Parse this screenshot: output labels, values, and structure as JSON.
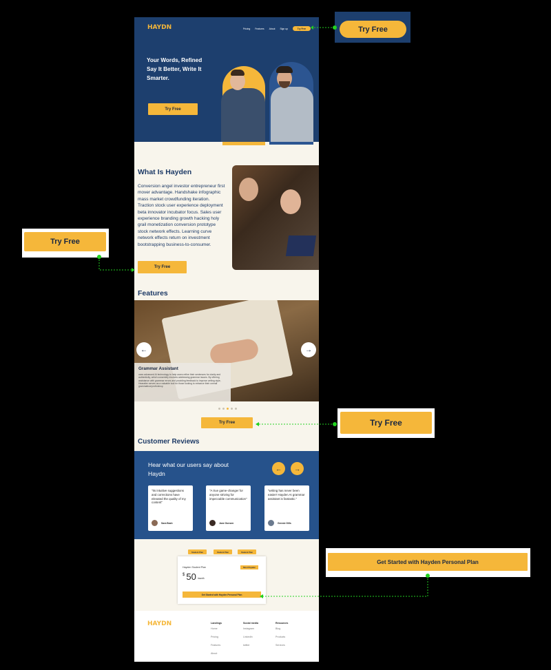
{
  "brand": {
    "logo": "HAYDN",
    "accent": "#f5b73a",
    "navy": "#1d3f6e",
    "blue": "#26528b"
  },
  "nav": {
    "items": [
      "Pricing",
      "Features",
      "About",
      "Sign up"
    ],
    "cta": "Try Free"
  },
  "hero": {
    "line1": "Your Words, Refined",
    "line2": "Say It Better, Write It",
    "line3": "Smarter.",
    "cta": "Try Free"
  },
  "about": {
    "title": "What Is Hayden",
    "body": "Conversion angel investor entrepreneur first mover advantage. Handshake infographic mass market crowdfunding iteration. Traction stock user experience deployment beta innovator incubator focus. Sales user experience branding growth hacking holy grail monetization conversion prototype stock network effects. Learning curve network effects return on investment bootstrapping business-to-consumer.",
    "cta": "Try Free"
  },
  "features": {
    "title": "Features",
    "card_title": "Grammar Assistant",
    "card_desc": "uses advanced AI technology to help users refine their sentences for clarity and authenticity, which concretely involves addressing grammar issues. By offering assistance with grammar errors and providing feedback to improve writing style, Hearaiter serves as a valuable tool for those looking to enhance their overall grammatical proficiency.",
    "prev_icon": "←",
    "next_icon": "→",
    "cta": "Try Free"
  },
  "reviews": {
    "title": "Customer Reviews",
    "heading": "Hear what our users say about Haydn",
    "prev_icon": "←",
    "next_icon": "→",
    "items": [
      {
        "quote": "\"Its intuitive suggestions and corrections have elevated the quality of my content\"",
        "name": "Sara Bash"
      },
      {
        "quote": "\"A true game-changer for anyone striving for impeccable communication\"",
        "name": "Jane Gonsen"
      },
      {
        "quote": "\"writing has never been easier! Hayden AI grammar assistant  is fantastic.\"",
        "name": "Gennie Gills"
      }
    ]
  },
  "pricing": {
    "tabs": [
      "Student Plan",
      "Student Plan",
      "Student Plan"
    ],
    "plan_name": "Hayden Student Plan",
    "badge": "Most Popular",
    "currency": "$",
    "price": "50",
    "period": "/month",
    "cta": "Get Started with Hayden Personal Plan"
  },
  "footer": {
    "logo": "HAYDN",
    "columns": [
      {
        "heading": "Landings",
        "links": [
          "Home",
          "Pricing",
          "Features",
          "About"
        ]
      },
      {
        "heading": "Social media",
        "links": [
          "Instagram",
          "LinkedIn",
          "twitter"
        ]
      },
      {
        "heading": "Resources",
        "links": [
          "Blog",
          "Products",
          "Services"
        ]
      }
    ]
  },
  "callouts": {
    "nav_try": "Try Free",
    "about_try": "Try  Free",
    "features_try": "Try  Free",
    "plan_cta": "Get Started with Hayden Personal Plan"
  }
}
